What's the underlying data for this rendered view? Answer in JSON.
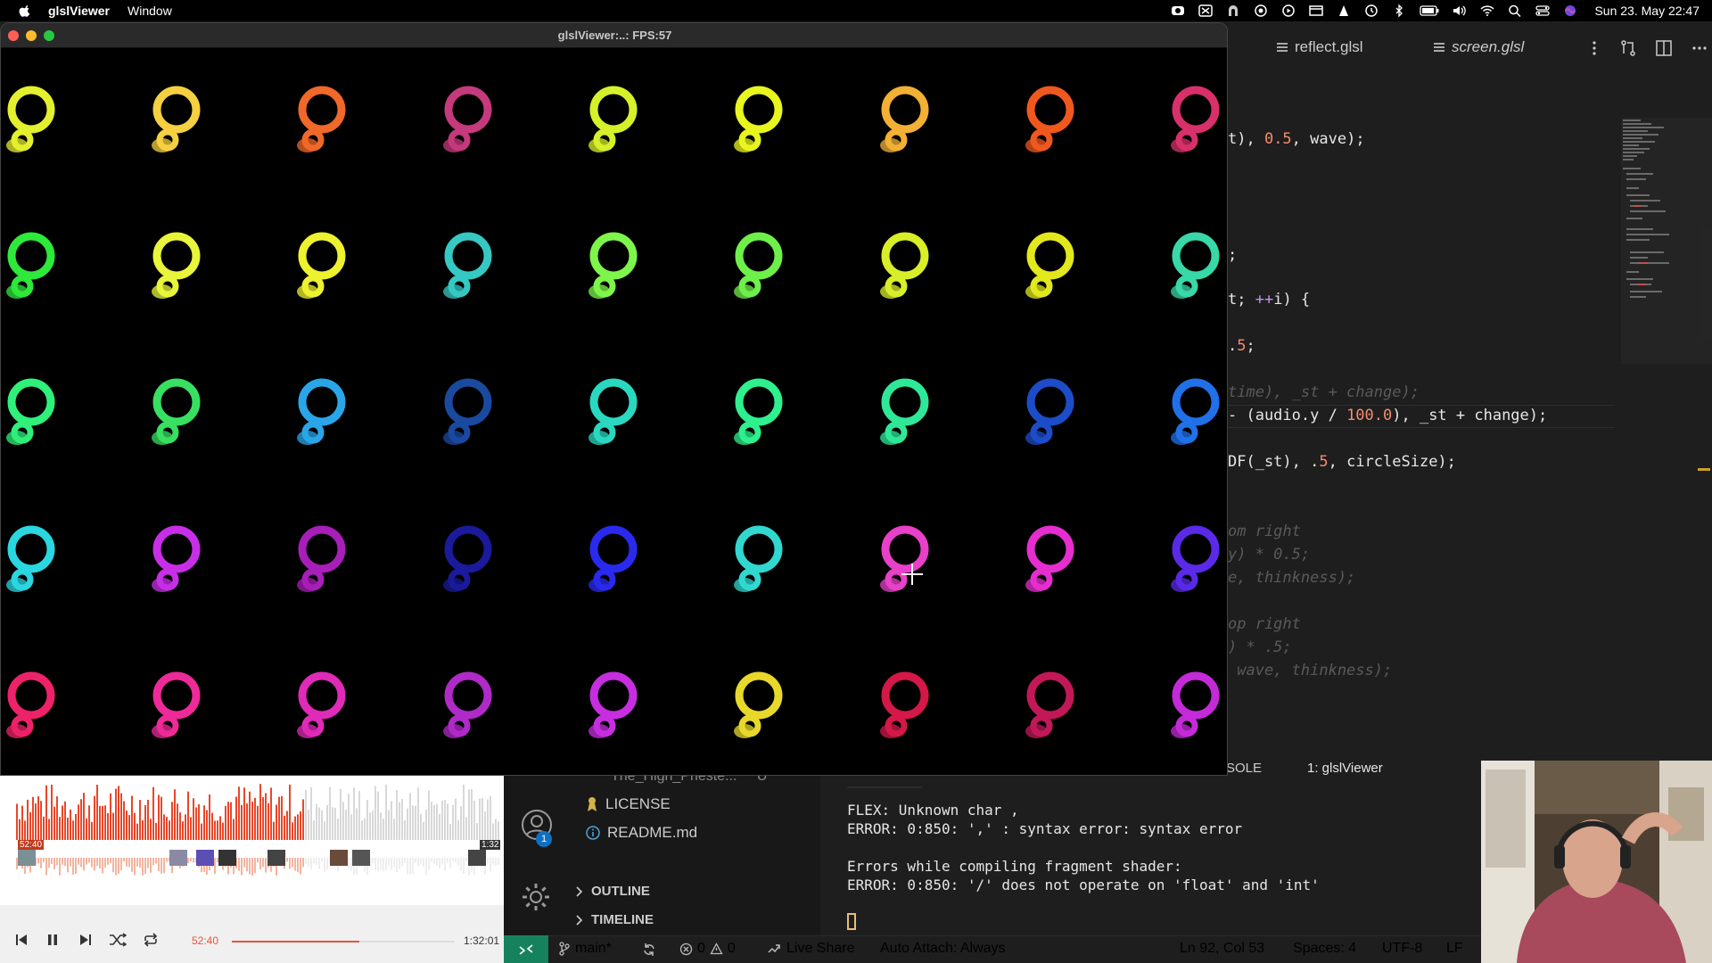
{
  "menubar": {
    "app_name": "glslViewer",
    "menu_window": "Window",
    "clock": "Sun 23. May  22:47"
  },
  "glsl_window": {
    "title": "glslViewer:..: FPS:57",
    "grid_rows": [
      [
        "#e4ef2e",
        "#f5d040",
        "#f0682a",
        "#c43a7c",
        "#d6f02a",
        "#e8f51e",
        "#f2b035",
        "#f0581e",
        "#d8306a"
      ],
      [
        "#2ee83a",
        "#e8f53a",
        "#eef22e",
        "#36c8c2",
        "#7ef54a",
        "#6ef04a",
        "#d8ee28",
        "#e2e81c",
        "#38d8a8"
      ],
      [
        "#2ef07a",
        "#38e062",
        "#2aa6e8",
        "#1a4aa0",
        "#2ad8c0",
        "#2ef08e",
        "#2ee898",
        "#1c4cc8",
        "#2070e8"
      ],
      [
        "#2ad6e0",
        "#c82ee8",
        "#a81eb8",
        "#1a1a9a",
        "#2a2aee",
        "#30d8d0",
        "#e840c8",
        "#e62ed0",
        "#5a2ae8"
      ],
      [
        "#ee2268",
        "#ee2a98",
        "#e02ab8",
        "#b02ac8",
        "#c62ee0",
        "#e8d82a",
        "#d41848",
        "#c21858",
        "#c42ad8"
      ]
    ]
  },
  "editor": {
    "tabs": [
      "reflect.glsl",
      "screen.glsl"
    ],
    "lines": [
      {
        "parts": [
          [
            "t), ",
            ""
          ],
          [
            "0.5",
            "num"
          ],
          [
            ", wave);",
            ""
          ]
        ],
        "comment": false
      },
      {
        "parts": [
          [
            ";",
            ""
          ]
        ],
        "comment": false
      },
      {
        "parts": [
          [
            "t; ",
            ""
          ],
          [
            "++",
            "kw"
          ],
          [
            "i) {",
            ""
          ]
        ],
        "comment": false
      },
      {
        "parts": [
          [
            ".",
            ""
          ],
          [
            "5",
            "num"
          ],
          [
            ";",
            ""
          ]
        ],
        "comment": false
      },
      {
        "parts": [
          [
            "time), _st + change);",
            ""
          ]
        ],
        "comment": true
      },
      {
        "parts": [
          [
            "- (audio.y / ",
            ""
          ],
          [
            "100.0",
            "num"
          ],
          [
            "), _st + change);",
            ""
          ]
        ],
        "comment": false
      },
      {
        "parts": [
          [
            "DF(_st), .",
            ""
          ],
          [
            "5",
            "num"
          ],
          [
            ", circleSize);",
            ""
          ]
        ],
        "comment": false
      },
      {
        "parts": [
          [
            "om right",
            ""
          ]
        ],
        "comment": true
      },
      {
        "parts": [
          [
            "y) * 0.5;",
            ""
          ]
        ],
        "comment": true
      },
      {
        "parts": [
          [
            "e, thinkness);",
            ""
          ]
        ],
        "comment": true
      },
      {
        "parts": [
          [
            "op right",
            ""
          ]
        ],
        "comment": true
      },
      {
        "parts": [
          [
            ") * .5;",
            ""
          ]
        ],
        "comment": true
      },
      {
        "parts": [
          [
            " wave, thinkness);",
            ""
          ]
        ],
        "comment": true
      }
    ]
  },
  "sidebar": {
    "partial_file": "The_High_Prieste...",
    "partial_badge": "U",
    "files": [
      "LICENSE",
      "README.md"
    ],
    "sections": [
      "OUTLINE",
      "TIMELINE"
    ],
    "account_badge": "1"
  },
  "panel": {
    "tab_console": "SOLE",
    "tab_terminal": "1: glslViewer",
    "terminal_lines": [
      "FLEX: Unknown char ,",
      "ERROR: 0:850: ',' : syntax error: syntax error",
      "",
      "Errors while compiling fragment shader:",
      "ERROR: 0:850: '/' does not operate on 'float' and 'int'"
    ]
  },
  "statusbar": {
    "branch": "main*",
    "errors": "0",
    "warnings": "0",
    "live_share": "Live Share",
    "auto_attach": "Auto Attach: Always",
    "position": "Ln 92, Col 53",
    "spaces": "Spaces: 4",
    "encoding": "UTF-8",
    "eol": "LF"
  },
  "player": {
    "elapsed": "52:40",
    "total": "1:32:01",
    "progress": 0.57,
    "marker_left": "52:40",
    "marker_right": "1:32"
  },
  "colors": {
    "accent_remote": "#16825d",
    "waveform_played": "#e8472a",
    "terminal_cursor": "#e5c07b"
  }
}
